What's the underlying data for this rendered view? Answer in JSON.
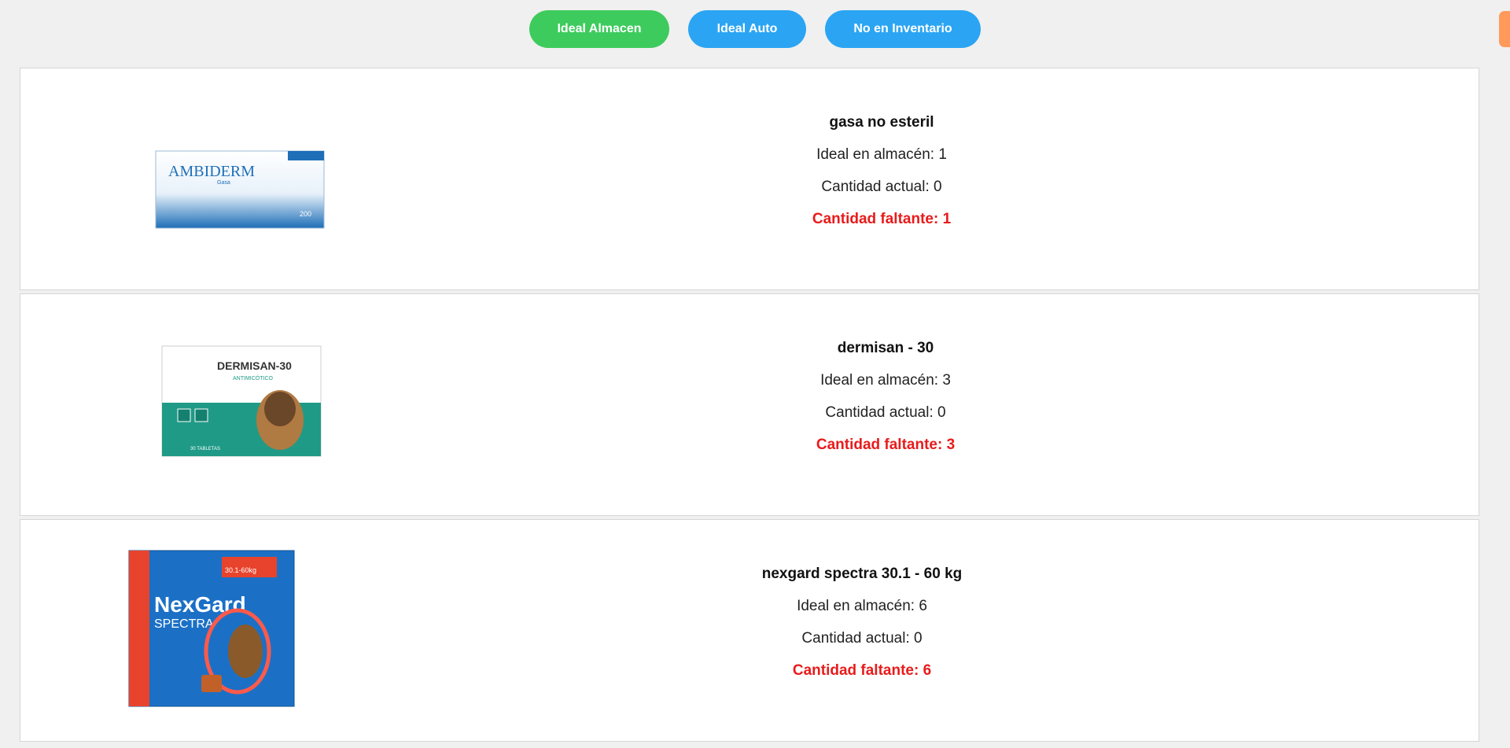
{
  "toolbar": {
    "ideal_almacen": "Ideal Almacen",
    "ideal_auto": "Ideal Auto",
    "no_inventario": "No en Inventario"
  },
  "products": [
    {
      "name": "gasa no esteril",
      "ideal": "Ideal en almacén: 1",
      "actual": "Cantidad actual: 0",
      "missing": "Cantidad faltante: 1",
      "image_brand": "AMBIDERM",
      "image_sub": "Gasa",
      "image_count": "200"
    },
    {
      "name": "dermisan - 30",
      "ideal": "Ideal en almacén: 3",
      "actual": "Cantidad actual: 0",
      "missing": "Cantidad faltante: 3",
      "image_brand": "DERMISAN-30",
      "image_sub": "ANTIMICÓTICO",
      "image_count": "30 TABLETAS"
    },
    {
      "name": "nexgard spectra 30.1 - 60 kg",
      "ideal": "Ideal en almacén: 6",
      "actual": "Cantidad actual: 0",
      "missing": "Cantidad faltante: 6",
      "image_brand": "NexGard",
      "image_sub": "SPECTRA",
      "image_count": "30.1-60kg"
    }
  ],
  "colors": {
    "green_button": "#3ecb5d",
    "blue_button": "#2ba5f3",
    "missing_text": "#e81b1b",
    "scroll_accent": "#ff9a5a"
  }
}
